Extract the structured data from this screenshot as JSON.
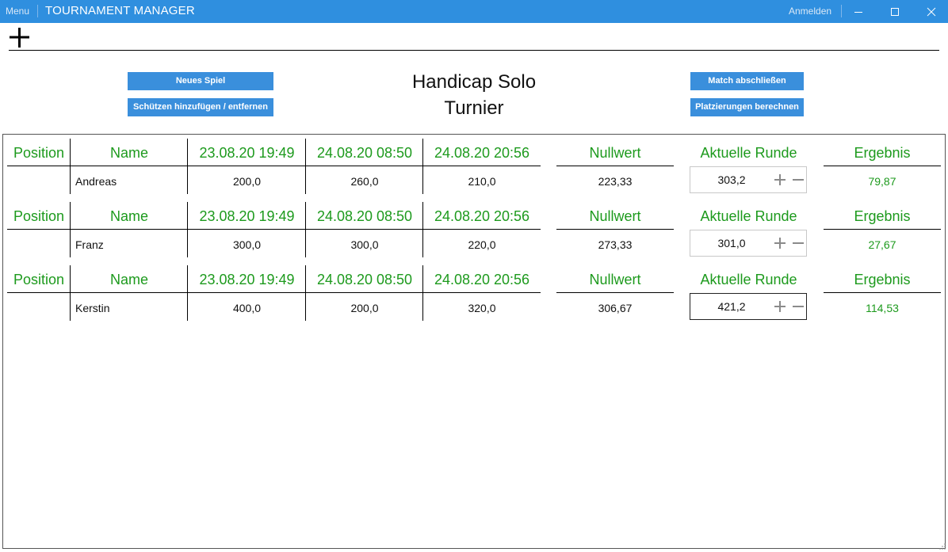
{
  "titlebar": {
    "menu_label": "Menu",
    "app_title": "TOURNAMENT MANAGER",
    "login_label": "Anmelden"
  },
  "actions": {
    "new_game": "Neues Spiel",
    "shooters": "Schützen hinzufügen / entfernen",
    "finish_match": "Match abschließen",
    "calc_rankings": "Platzierungen berechnen"
  },
  "tournament": {
    "title_line1": "Handicap Solo",
    "title_line2": "Turnier"
  },
  "columns": {
    "position": "Position",
    "name": "Name",
    "round1": "23.08.20 19:49",
    "round2": "24.08.20 08:50",
    "round3": "24.08.20 20:56",
    "zero": "Nullwert",
    "current": "Aktuelle Runde",
    "result": "Ergebnis"
  },
  "players": [
    {
      "position": "",
      "name": "Andreas",
      "r1": "200,0",
      "r2": "260,0",
      "r3": "210,0",
      "zero": "223,33",
      "current": "303,2",
      "result": "79,87"
    },
    {
      "position": "",
      "name": "Franz",
      "r1": "300,0",
      "r2": "300,0",
      "r3": "220,0",
      "zero": "273,33",
      "current": "301,0",
      "result": "27,67"
    },
    {
      "position": "",
      "name": "Kerstin",
      "r1": "400,0",
      "r2": "200,0",
      "r3": "320,0",
      "zero": "306,67",
      "current": "421,2",
      "result": "114,53"
    }
  ],
  "colors": {
    "titlebar": "#2f8fdf",
    "button": "#3a8fdc",
    "header_green": "#1d9a1d"
  }
}
